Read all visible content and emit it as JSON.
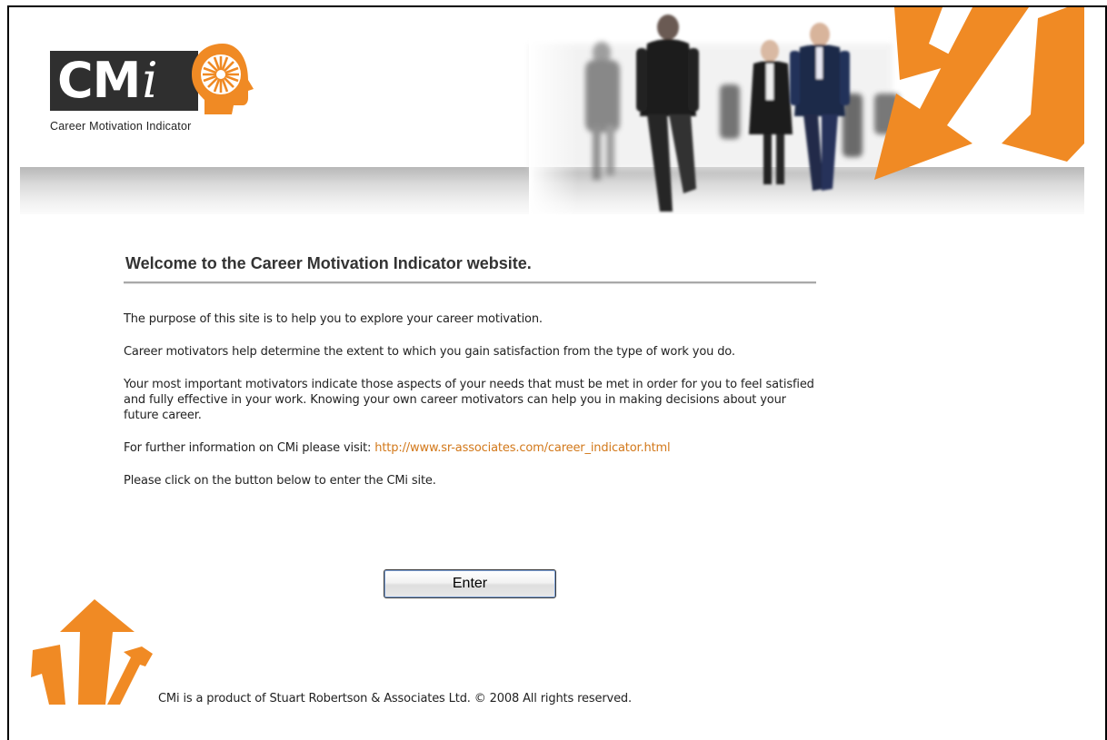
{
  "header": {
    "logo_text": "CM",
    "logo_i": "i",
    "logo_tagline": "Career Motivation Indicator",
    "logo_icon": "head-starburst-icon",
    "banner_image": "commuters-walking-photo",
    "decor_icon": "orange-arrows-icon"
  },
  "main": {
    "heading": "Welcome to the Career Motivation Indicator website.",
    "paragraphs": [
      "The purpose of this site is to help you to explore your career motivation.",
      "Career motivators help determine the extent to which you gain satisfaction from the type of work you do.",
      "Your most important motivators indicate those aspects of your needs that must be met in order for you to feel satisfied and fully effective in your work. Knowing your own career motivators can help you in making decisions about your future career."
    ],
    "info_prefix": "For further information on CMi please visit:",
    "info_link": "http://www.sr-associates.com/career_indicator.html",
    "click_instruction": "Please click on the button below to enter the CMi site.",
    "enter_label": "Enter"
  },
  "footer": {
    "copyright": "CMi is a product of Stuart Robertson & Associates Ltd.  © 2008 All rights reserved."
  },
  "colors": {
    "accent_orange": "#f08a24",
    "link_orange": "#d2781a",
    "logo_dark": "#2f2f2f",
    "heading_gray": "#333333"
  }
}
